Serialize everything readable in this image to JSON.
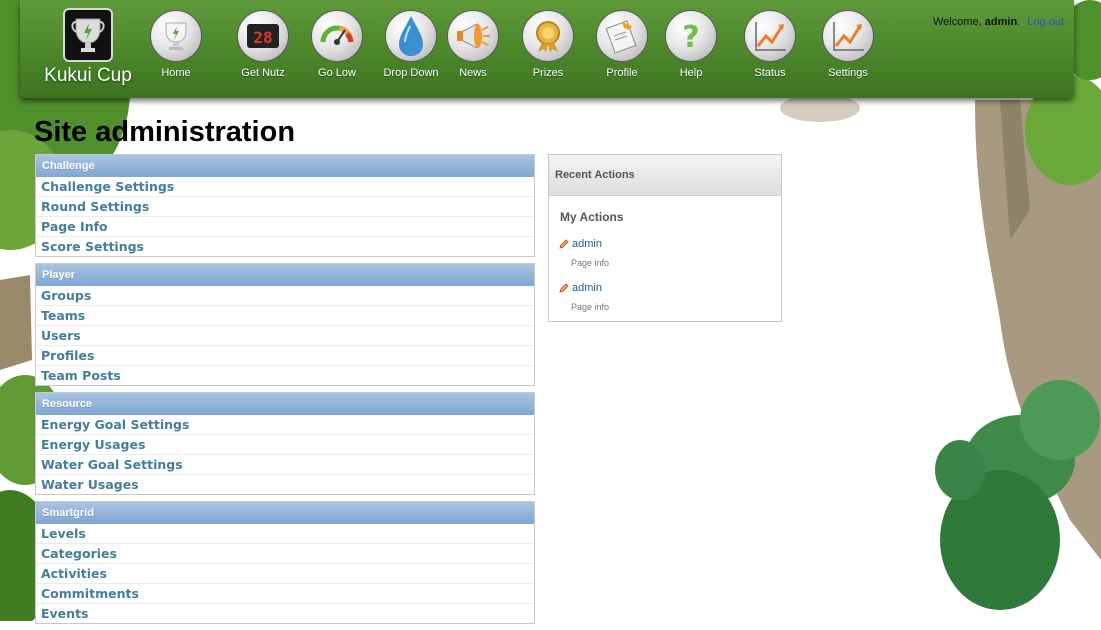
{
  "header": {
    "brand": "Kukui Cup",
    "welcome_prefix": "Welcome,",
    "username": "admin",
    "logout_label": "Log out",
    "nav_items": [
      {
        "label": "Home",
        "icon": "trophy-icon"
      },
      {
        "label": "Get Nutz",
        "icon": "scoreboard-icon"
      },
      {
        "label": "Go Low",
        "icon": "gauge-icon"
      },
      {
        "label": "Drop Down",
        "icon": "water-drop-icon"
      },
      {
        "label": "News",
        "icon": "megaphone-icon"
      },
      {
        "label": "Prizes",
        "icon": "medal-icon"
      },
      {
        "label": "Profile",
        "icon": "profile-card-icon"
      },
      {
        "label": "Help",
        "icon": "question-mark-icon"
      },
      {
        "label": "Status",
        "icon": "trend-chart-icon"
      },
      {
        "label": "Settings",
        "icon": "trend-chart-icon"
      }
    ]
  },
  "page": {
    "title": "Site administration"
  },
  "modules": [
    {
      "name": "Challenge",
      "items": [
        "Challenge Settings",
        "Round Settings",
        "Page Info",
        "Score Settings"
      ]
    },
    {
      "name": "Player",
      "items": [
        "Groups",
        "Teams",
        "Users",
        "Profiles",
        "Team Posts"
      ]
    },
    {
      "name": "Resource",
      "items": [
        "Energy Goal Settings",
        "Energy Usages",
        "Water Goal Settings",
        "Water Usages"
      ]
    },
    {
      "name": "Smartgrid",
      "items": [
        "Levels",
        "Categories",
        "Activities",
        "Commitments",
        "Events"
      ]
    }
  ],
  "recent_actions": {
    "title": "Recent Actions",
    "subtitle": "My Actions",
    "items": [
      {
        "link": "admin",
        "type": "Page info"
      },
      {
        "link": "admin",
        "type": "Page info"
      }
    ]
  },
  "colors": {
    "banner_green": "#4e8a2c",
    "module_header_blue": "#7fa7d1",
    "link_blue": "#447e9b",
    "logout_blue": "#274ec9"
  }
}
